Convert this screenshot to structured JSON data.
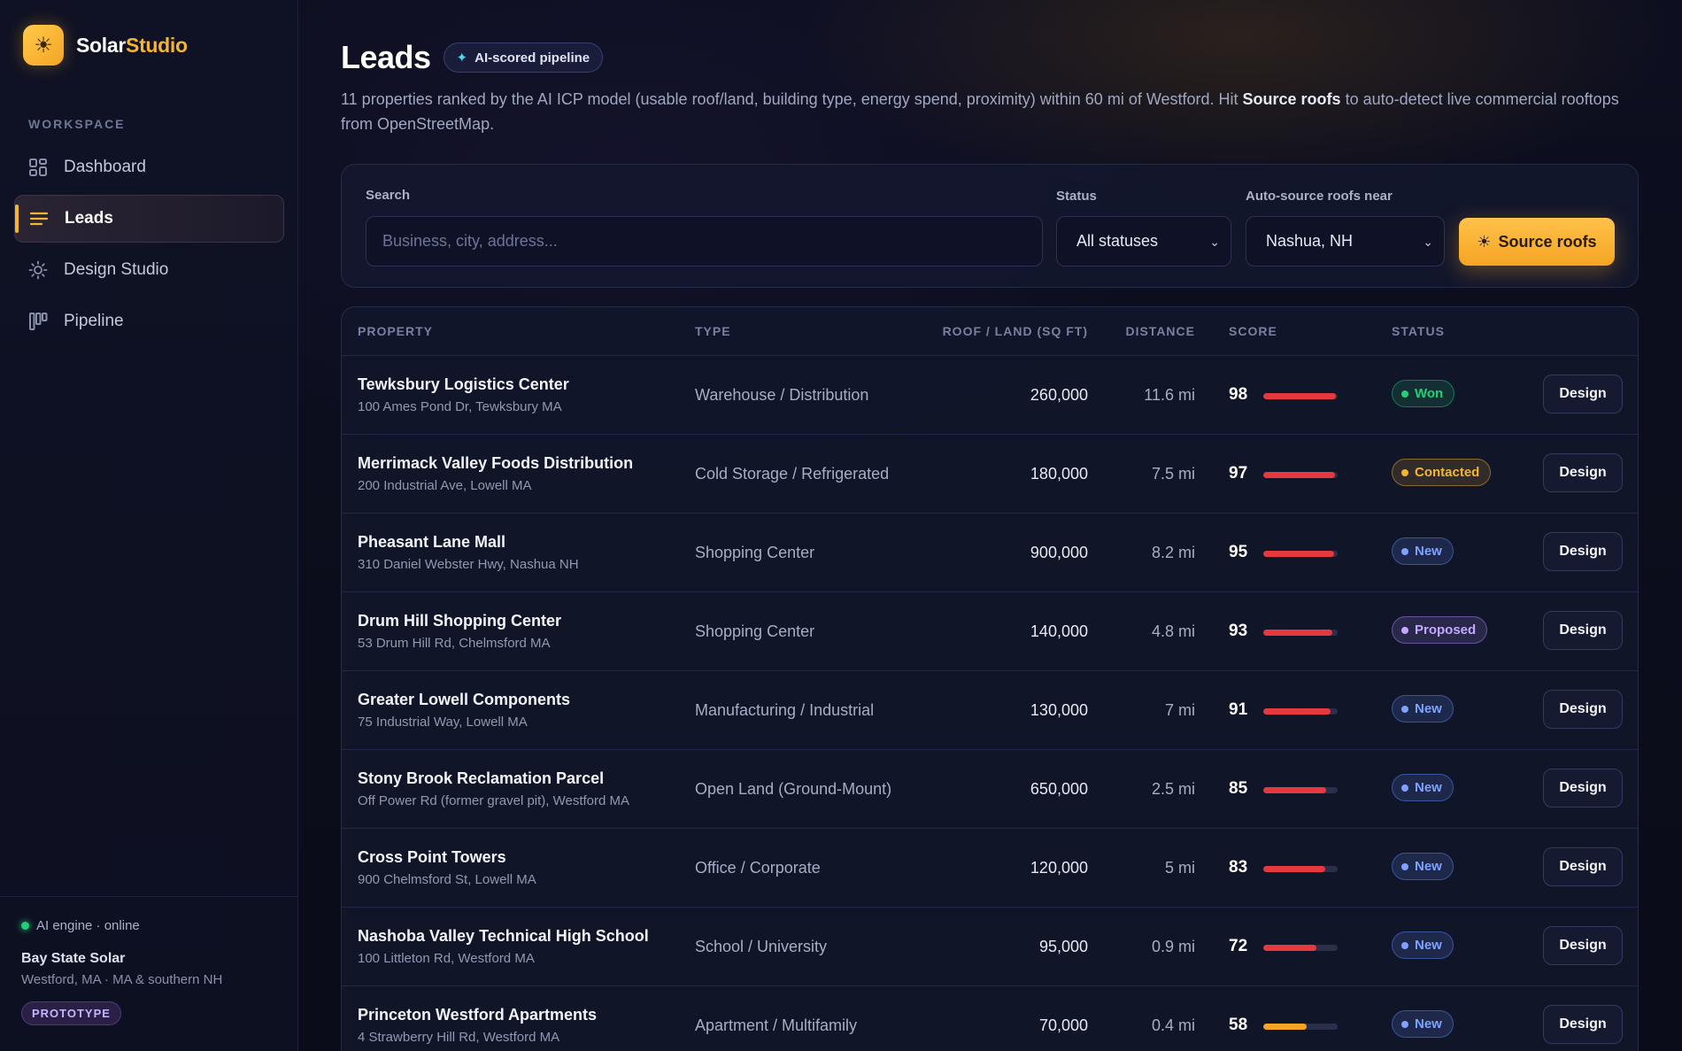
{
  "brand": {
    "name_main": "Solar",
    "name_accent": "Studio",
    "logo_icon": "sun-icon"
  },
  "sidebar": {
    "section_label": "WORKSPACE",
    "items": [
      {
        "label": "Dashboard",
        "icon": "grid-icon",
        "active": false
      },
      {
        "label": "Leads",
        "icon": "list-icon",
        "active": true
      },
      {
        "label": "Design Studio",
        "icon": "sun-icon",
        "active": false
      },
      {
        "label": "Pipeline",
        "icon": "kanban-icon",
        "active": false
      }
    ],
    "footer": {
      "engine_status": "AI engine · online",
      "company": "Bay State Solar",
      "company_sub": "Westford, MA · MA & southern NH",
      "badge": "PROTOTYPE"
    }
  },
  "header": {
    "title": "Leads",
    "badge": "AI-scored pipeline",
    "desc_part1": "11 properties ranked by the AI ICP model (usable roof/land, building type, energy spend, proximity) within 60 mi of Westford. Hit ",
    "desc_bold": "Source roofs",
    "desc_part2": " to auto-detect live commercial rooftops from OpenStreetMap."
  },
  "filters": {
    "search_label": "Search",
    "search_placeholder": "Business, city, address...",
    "status_label": "Status",
    "status_value": "All statuses",
    "source_label": "Auto-source roofs near",
    "source_value": "Nashua, NH",
    "source_button": "Source roofs"
  },
  "table": {
    "headers": {
      "property": "PROPERTY",
      "type": "TYPE",
      "area": "ROOF / LAND (SQ FT)",
      "distance": "DISTANCE",
      "score": "SCORE",
      "status": "STATUS"
    },
    "design_label": "Design",
    "rows": [
      {
        "name": "Tewksbury Logistics Center",
        "address": "100 Ames Pond Dr, Tewksbury MA",
        "type": "Warehouse / Distribution",
        "area": "260,000",
        "distance": "11.6 mi",
        "score": "98",
        "score_pct": 0.98,
        "status": "Won"
      },
      {
        "name": "Merrimack Valley Foods Distribution",
        "address": "200 Industrial Ave, Lowell MA",
        "type": "Cold Storage / Refrigerated",
        "area": "180,000",
        "distance": "7.5 mi",
        "score": "97",
        "score_pct": 0.97,
        "status": "Contacted"
      },
      {
        "name": "Pheasant Lane Mall",
        "address": "310 Daniel Webster Hwy, Nashua NH",
        "type": "Shopping Center",
        "area": "900,000",
        "distance": "8.2 mi",
        "score": "95",
        "score_pct": 0.95,
        "status": "New"
      },
      {
        "name": "Drum Hill Shopping Center",
        "address": "53 Drum Hill Rd, Chelmsford MA",
        "type": "Shopping Center",
        "area": "140,000",
        "distance": "4.8 mi",
        "score": "93",
        "score_pct": 0.93,
        "status": "Proposed"
      },
      {
        "name": "Greater Lowell Components",
        "address": "75 Industrial Way, Lowell MA",
        "type": "Manufacturing / Industrial",
        "area": "130,000",
        "distance": "7 mi",
        "score": "91",
        "score_pct": 0.91,
        "status": "New"
      },
      {
        "name": "Stony Brook Reclamation Parcel",
        "address": "Off Power Rd (former gravel pit), Westford MA",
        "type": "Open Land (Ground-Mount)",
        "area": "650,000",
        "distance": "2.5 mi",
        "score": "85",
        "score_pct": 0.85,
        "status": "New"
      },
      {
        "name": "Cross Point Towers",
        "address": "900 Chelmsford St, Lowell MA",
        "type": "Office / Corporate",
        "area": "120,000",
        "distance": "5 mi",
        "score": "83",
        "score_pct": 0.83,
        "status": "New"
      },
      {
        "name": "Nashoba Valley Technical High School",
        "address": "100 Littleton Rd, Westford MA",
        "type": "School / University",
        "area": "95,000",
        "distance": "0.9 mi",
        "score": "72",
        "score_pct": 0.72,
        "status": "New"
      },
      {
        "name": "Princeton Westford Apartments",
        "address": "4 Strawberry Hill Rd, Westford MA",
        "type": "Apartment / Multifamily",
        "area": "70,000",
        "distance": "0.4 mi",
        "score": "58",
        "score_pct": 0.58,
        "status": "New"
      }
    ]
  },
  "colors": {
    "accent": "#f5b533",
    "score_high": "#e5393f",
    "score_mid": "#f5a524",
    "status_won": "#22d07a",
    "status_contacted": "#f5b533",
    "status_new": "#5b8cff",
    "status_proposed": "#b18cff"
  }
}
